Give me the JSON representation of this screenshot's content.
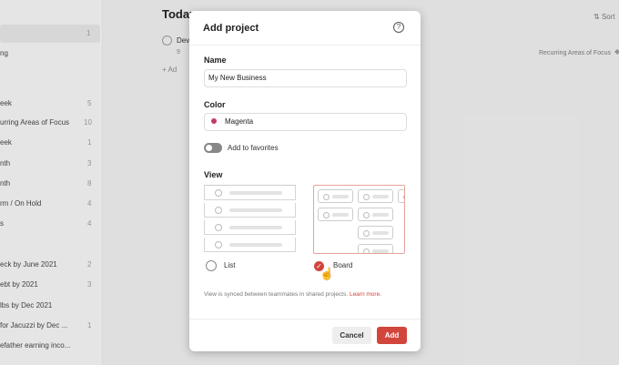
{
  "background": {
    "sidebar": {
      "top_count": "1",
      "items": [
        {
          "label": "ng",
          "count": ""
        },
        {
          "label": "eek",
          "count": "5"
        },
        {
          "label": "urring Areas of Focus",
          "count": "10"
        },
        {
          "label": "eek",
          "count": "1"
        },
        {
          "label": "nth",
          "count": "3"
        },
        {
          "label": "nth",
          "count": "8"
        },
        {
          "label": "rm / On Hold",
          "count": "4"
        },
        {
          "label": "s",
          "count": "4"
        },
        {
          "label": "eck by June 2021",
          "count": "2"
        },
        {
          "label": "ebt by 2021",
          "count": "3"
        },
        {
          "label": "lbs by Dec 2021",
          "count": ""
        },
        {
          "label": "for Jacuzzi by Dec ...",
          "count": "1"
        },
        {
          "label": "efather earning inco...",
          "count": ""
        }
      ]
    },
    "main": {
      "title": "Today",
      "task_text": "Dev",
      "task_meta": "9",
      "add_task": "+ Ad",
      "sort_label": "Sort",
      "recurring_tag": "Recurring Areas of Focus"
    }
  },
  "modal": {
    "title": "Add project",
    "help_icon": "?",
    "name_label": "Name",
    "name_value": "My New Business",
    "color_label": "Color",
    "color_value": "Magenta",
    "color_hex": "#c0396b",
    "favorites_label": "Add to favorites",
    "favorites_on": false,
    "view_label": "View",
    "view_options": [
      {
        "label": "List",
        "selected": false
      },
      {
        "label": "Board",
        "selected": true
      }
    ],
    "sync_note": "View is synced between teammates in shared projects.",
    "learn_more": "Learn more.",
    "cancel_label": "Cancel",
    "add_label": "Add",
    "accent_color": "#d1453b"
  }
}
